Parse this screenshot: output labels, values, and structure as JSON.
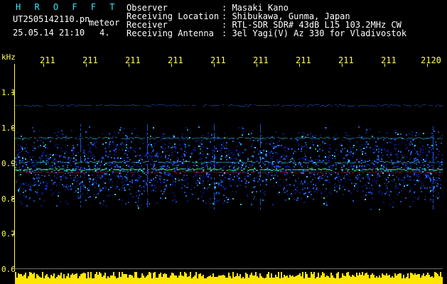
{
  "header": {
    "station": "H R O F F T",
    "filename": "UT2505142110.pn",
    "suffix": "meteor",
    "datetime": "25.05.14 21:10",
    "count": "4.",
    "observer_label": "Observer",
    "observer_value": ": Masaki Kano",
    "location_label": "Receiving Location",
    "location_value": ": Shibukawa, Gunma, Japan",
    "receiver_label": "Receiver",
    "receiver_value": ": RTL-SDR SDR# 43dB L15 103.2MHz CW",
    "antenna_label": "Receiving Antenna",
    "antenna_value": ": 3el Yagi(V) Az 330 for Vladivostok"
  },
  "yaxis": {
    "unit": "kHz",
    "ticks": [
      "1.1",
      "1.0",
      "0.9",
      "0.8",
      "0.7",
      "0.6"
    ]
  },
  "xaxis": {
    "ticks": [
      "211",
      "211",
      "211",
      "211",
      "211",
      "211",
      "211",
      "211",
      "211",
      "2120"
    ]
  },
  "colors": {
    "axis": "#ffff55",
    "accent": "#38e8ff",
    "noise_low": "#0a1a8c",
    "noise_mid": "#1e6cff",
    "signal": "#ff2a2a"
  }
}
